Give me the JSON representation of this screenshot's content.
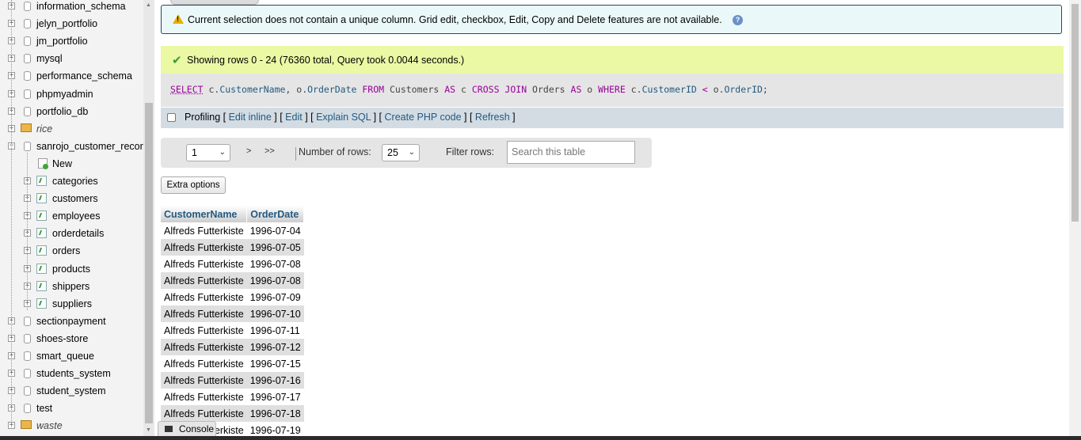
{
  "sidebar": {
    "databases_top": [
      {
        "name": "information_schema"
      },
      {
        "name": "jelyn_portfolio"
      },
      {
        "name": "jm_portfolio"
      },
      {
        "name": "mysql"
      },
      {
        "name": "performance_schema"
      },
      {
        "name": "phpmyadmin"
      },
      {
        "name": "portfolio_db"
      },
      {
        "name": "rice"
      }
    ],
    "open_db": {
      "name": "sanrojo_customer_recor",
      "new_label": "New",
      "tables": [
        "categories",
        "customers",
        "employees",
        "orderdetails",
        "orders",
        "products",
        "shippers",
        "suppliers"
      ]
    },
    "databases_bottom": [
      {
        "name": "sectionpayment"
      },
      {
        "name": "shoes-store"
      },
      {
        "name": "smart_queue"
      },
      {
        "name": "students_system"
      },
      {
        "name": "student_system"
      },
      {
        "name": "test"
      },
      {
        "name": "waste"
      }
    ]
  },
  "notice": {
    "text": "Current selection does not contain a unique column. Grid edit, checkbox, Edit, Copy and Delete features are not available."
  },
  "success": {
    "text": "Showing rows 0 - 24 (76360 total, Query took 0.0044 seconds.)"
  },
  "sql": {
    "select": "SELECT",
    "p1": " c.",
    "col1": "CustomerName",
    "p2": ", o.",
    "col2": "OrderDate",
    "from": " FROM",
    "p3": " Customers",
    "as1": " AS",
    "p4": " c",
    "cross": " CROSS JOIN",
    "p5": " Orders",
    "as2": " AS",
    "p6": " o",
    "where": " WHERE",
    "p7": " c.",
    "col3": "CustomerID",
    "lt": " <",
    "p8": " o.",
    "col4": "OrderID",
    "end": ";"
  },
  "profiling": {
    "label": "Profiling",
    "b1": " [ ",
    "edit_inline": "Edit inline",
    "b2": " ] [ ",
    "edit": "Edit",
    "b3": " ] [ ",
    "explain": "Explain SQL",
    "b4": " ] [ ",
    "php": "Create PHP code",
    "b5": " ] [ ",
    "refresh": "Refresh",
    "b6": " ]"
  },
  "navigation": {
    "page_value": "1",
    "next": ">",
    "last": ">>",
    "rows_label": "Number of rows:",
    "rows_value": "25",
    "filter_label": "Filter rows:",
    "search_placeholder": "Search this table"
  },
  "extra_options_label": "Extra options",
  "results": {
    "headers": [
      "CustomerName",
      "OrderDate"
    ],
    "rows": [
      [
        "Alfreds Futterkiste",
        "1996-07-04"
      ],
      [
        "Alfreds Futterkiste",
        "1996-07-05"
      ],
      [
        "Alfreds Futterkiste",
        "1996-07-08"
      ],
      [
        "Alfreds Futterkiste",
        "1996-07-08"
      ],
      [
        "Alfreds Futterkiste",
        "1996-07-09"
      ],
      [
        "Alfreds Futterkiste",
        "1996-07-10"
      ],
      [
        "Alfreds Futterkiste",
        "1996-07-11"
      ],
      [
        "Alfreds Futterkiste",
        "1996-07-12"
      ],
      [
        "Alfreds Futterkiste",
        "1996-07-15"
      ],
      [
        "Alfreds Futterkiste",
        "1996-07-16"
      ],
      [
        "Alfreds Futterkiste",
        "1996-07-17"
      ],
      [
        "Alfreds Futterkiste",
        "1996-07-18"
      ],
      [
        "Alfreds Futterkiste",
        "1996-07-19"
      ]
    ]
  },
  "console_label": "Console",
  "colors": {
    "link": "#235a81",
    "notice_bg": "#ebf8fa",
    "success_bg": "#ebf8a4",
    "sql_keyword": "#990099"
  }
}
